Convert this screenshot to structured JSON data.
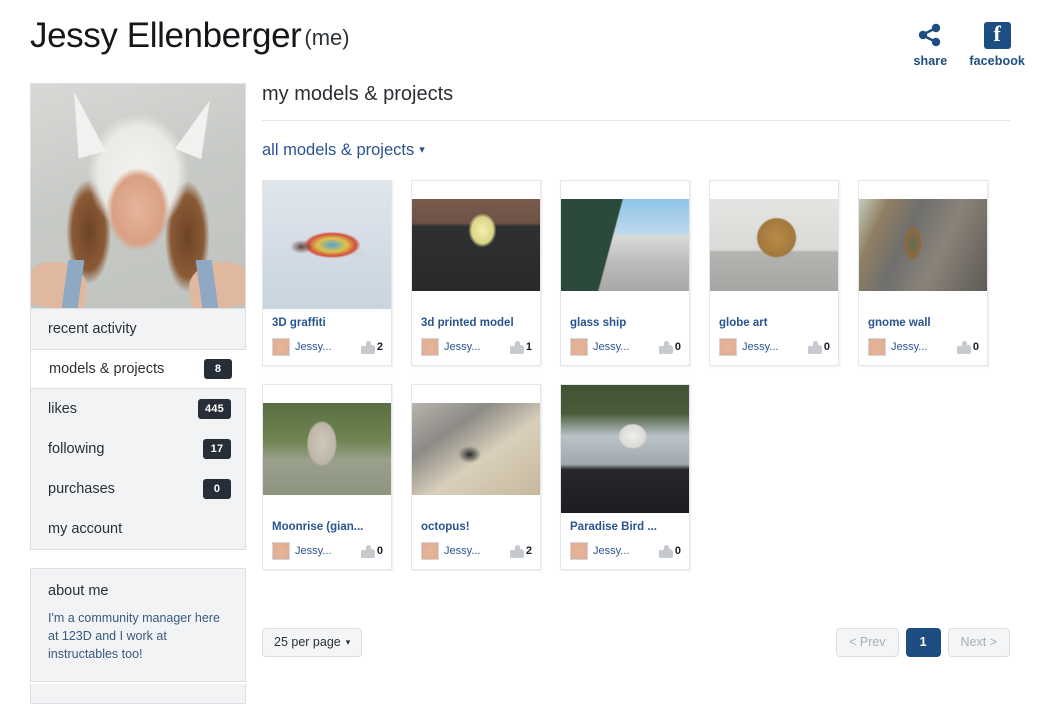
{
  "header": {
    "profile_name": "Jessy Ellenberger",
    "profile_suffix": "(me)",
    "share_label": "share",
    "facebook_label": "facebook",
    "facebook_glyph": "f",
    "accent_color": "#1d4d82"
  },
  "sidebar": {
    "nav": [
      {
        "label": "recent activity",
        "badge": "",
        "active": false
      },
      {
        "label": "models & projects",
        "badge": "8",
        "active": true
      },
      {
        "label": "likes",
        "badge": "445",
        "active": false
      },
      {
        "label": "following",
        "badge": "17",
        "active": false
      },
      {
        "label": "purchases",
        "badge": "0",
        "active": false
      },
      {
        "label": "my account",
        "badge": "",
        "active": false
      }
    ],
    "about": {
      "title": "about me",
      "body": "I'm a community manager here at 123D and I work at instructables too!"
    }
  },
  "main": {
    "heading": "my models & projects",
    "filter_label": "all models & projects",
    "filter_caret": "▾",
    "cards": [
      {
        "title": "3D graffiti",
        "author": "Jessy...",
        "likes": "2"
      },
      {
        "title": "3d printed model",
        "author": "Jessy...",
        "likes": "1"
      },
      {
        "title": "glass ship",
        "author": "Jessy...",
        "likes": "0"
      },
      {
        "title": "globe art",
        "author": "Jessy...",
        "likes": "0"
      },
      {
        "title": "gnome wall",
        "author": "Jessy...",
        "likes": "0"
      },
      {
        "title": "Moonrise (gian...",
        "author": "Jessy...",
        "likes": "0"
      },
      {
        "title": "octopus!",
        "author": "Jessy...",
        "likes": "2"
      },
      {
        "title": "Paradise Bird ...",
        "author": "Jessy...",
        "likes": "0"
      }
    ]
  },
  "footer": {
    "per_page_label": "25 per page",
    "per_page_caret": "▾",
    "prev_label": "< Prev",
    "page_label": "1",
    "next_label": "Next >"
  }
}
